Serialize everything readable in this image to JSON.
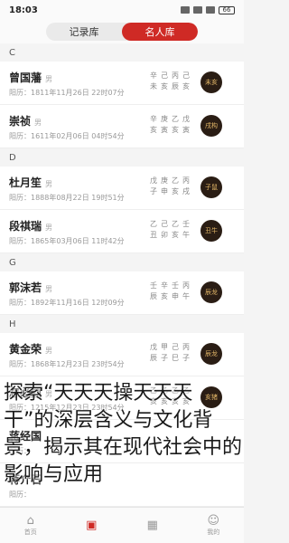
{
  "status": {
    "time": "18:03",
    "battery": "66"
  },
  "tabs": [
    {
      "label": "记录库",
      "active": false
    },
    {
      "label": "名人库",
      "active": true
    }
  ],
  "sections": [
    {
      "letter": "C",
      "people": [
        {
          "name": "曾国藩",
          "gender": "男",
          "date": "阳历：1811年11月26日 22时07分",
          "bazi": [
            "辛",
            "己",
            "丙",
            "己",
            "未",
            "亥",
            "辰",
            "亥"
          ],
          "badge": "未亥"
        },
        {
          "name": "崇祯",
          "gender": "男",
          "date": "阳历：1611年02月06日 04时54分",
          "bazi": [
            "辛",
            "庚",
            "乙",
            "戊",
            "亥",
            "寅",
            "亥",
            "寅"
          ],
          "badge": "戌构"
        }
      ]
    },
    {
      "letter": "D",
      "people": [
        {
          "name": "杜月笙",
          "gender": "男",
          "date": "阳历：1888年08月22日 19时51分",
          "bazi": [
            "戊",
            "庚",
            "乙",
            "丙",
            "子",
            "申",
            "亥",
            "戌"
          ],
          "badge": "子鼠"
        },
        {
          "name": "段祺瑞",
          "gender": "男",
          "date": "阳历：1865年03月06日 11时42分",
          "bazi": [
            "乙",
            "己",
            "乙",
            "壬",
            "丑",
            "卯",
            "亥",
            "午"
          ],
          "badge": "丑牛"
        }
      ]
    },
    {
      "letter": "G",
      "people": [
        {
          "name": "郭沫若",
          "gender": "男",
          "date": "阳历：1892年11月16日 12时09分",
          "bazi": [
            "壬",
            "辛",
            "壬",
            "丙",
            "辰",
            "亥",
            "申",
            "午"
          ],
          "badge": "辰龙"
        }
      ]
    },
    {
      "letter": "H",
      "people": [
        {
          "name": "黄金荣",
          "gender": "男",
          "date": "阳历：1868年12月23日 23时54分",
          "bazi": [
            "戊",
            "甲",
            "己",
            "丙",
            "辰",
            "子",
            "巳",
            "子"
          ],
          "badge": "辰龙"
        },
        {
          "name": "忽必烈",
          "gender": "男",
          "date": "阳历：1215年12月23日 23时54分",
          "bazi": [
            "乙",
            "乙",
            "乙",
            "乙",
            "亥",
            "亥",
            "亥",
            "亥"
          ],
          "badge": "亥猪"
        }
      ]
    }
  ],
  "partial_rows": [
    {
      "name": "蒋经国",
      "date": "阳历："
    },
    {
      "name": "蒋介石",
      "date": "阳历："
    }
  ],
  "overlay_text": "探索“天天天操天天天干”的深层含义与文化背景，揭示其在现代社会中的影响与应用",
  "tabbar": [
    {
      "label": "首页",
      "glyph": "⌂",
      "active": false
    },
    {
      "label": "",
      "glyph": "▣",
      "active": true
    },
    {
      "label": "",
      "glyph": "▦",
      "active": false
    },
    {
      "label": "我的",
      "glyph": "☺",
      "active": false
    }
  ]
}
